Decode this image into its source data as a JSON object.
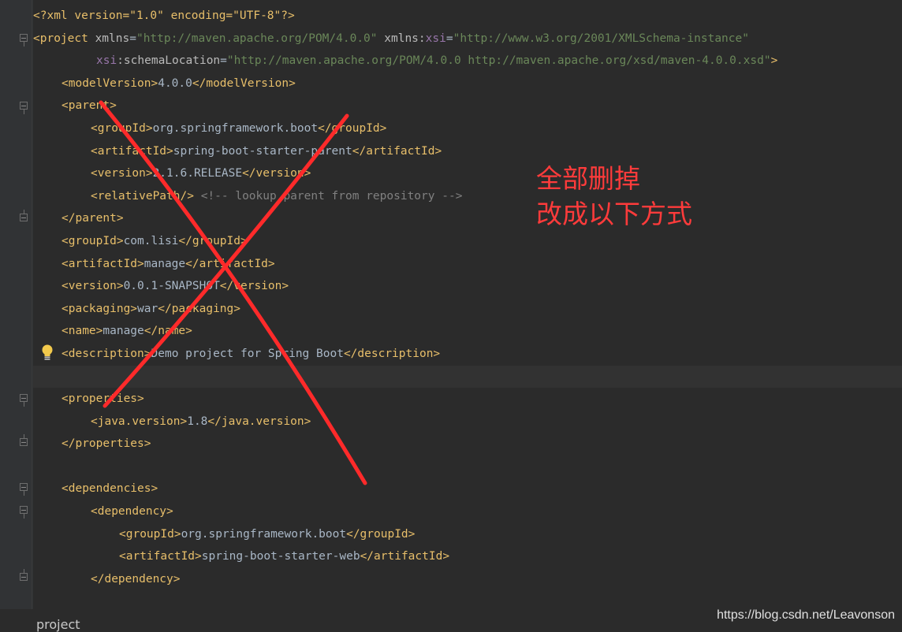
{
  "editor": {
    "xml_decl": "<?xml version=\"1.0\" encoding=\"UTF-8\"?>",
    "project_ns": "http://maven.apache.org/POM/4.0.0",
    "xsi_ns": "http://www.w3.org/2001/XMLSchema-instance",
    "schema_location": "http://maven.apache.org/POM/4.0.0 http://maven.apache.org/xsd/maven-4.0.0.xsd",
    "model_version": "4.0.0",
    "parent_group_id": "org.springframework.boot",
    "parent_artifact_id": "spring-boot-starter-parent",
    "parent_version": "2.1.6.RELEASE",
    "relative_path_comment": "<!-- lookup parent from repository -->",
    "group_id": "com.lisi",
    "artifact_id": "manage",
    "version": "0.0.1-SNAPSHOT",
    "packaging": "war",
    "name": "manage",
    "description": "Demo project for Spring Boot",
    "java_version": "1.8",
    "dep_group_id": "org.springframework.boot",
    "dep_artifact_id": "spring-boot-starter-web"
  },
  "annotation": {
    "line1": "全部删掉",
    "line2": "改成以下方式",
    "color": "#ff3b3b"
  },
  "breadcrumb": "project",
  "watermark": "https://blog.csdn.net/Leavonson",
  "icons": [
    "fold-icon",
    "lightbulb-icon"
  ]
}
